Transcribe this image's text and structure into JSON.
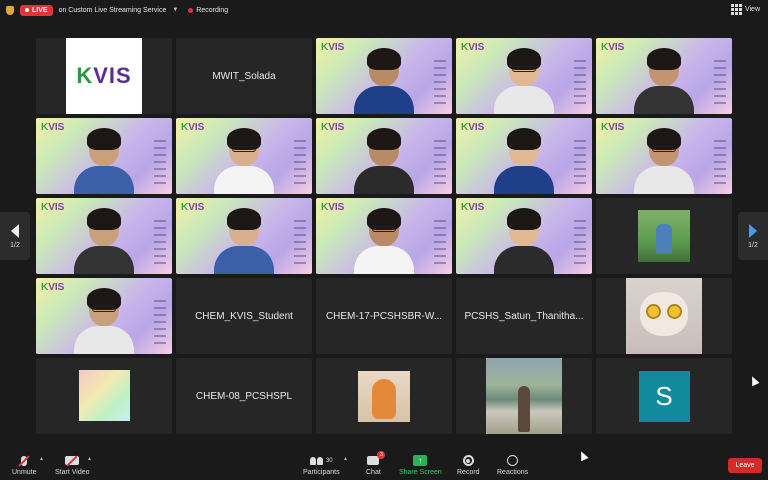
{
  "topbar": {
    "live_label": "LIVE",
    "stream_label": "on Custom Live Streaming Service",
    "recording_label": "Recording",
    "view_label": "View"
  },
  "colors": {
    "live_red": "#e0333a",
    "active_speaker": "#27c24c",
    "share_green": "#28b35b",
    "leave_red": "#d12b2b",
    "page_arrow_blue": "#3aa0f5",
    "avatar_teal": "#128a9e",
    "brand_purple": "#5a2d91",
    "brand_green": "#2f9a3d"
  },
  "kvis_logo": {
    "text_k": "K",
    "text_vis": "VIS"
  },
  "tiles": [
    {
      "type": "logo"
    },
    {
      "type": "name",
      "name": "MWIT_Solada"
    },
    {
      "type": "vbg"
    },
    {
      "type": "vbg",
      "active": true
    },
    {
      "type": "vbg"
    },
    {
      "type": "vbg"
    },
    {
      "type": "vbg"
    },
    {
      "type": "vbg"
    },
    {
      "type": "vbg"
    },
    {
      "type": "vbg"
    },
    {
      "type": "vbg"
    },
    {
      "type": "vbg"
    },
    {
      "type": "vbg"
    },
    {
      "type": "vbg"
    },
    {
      "type": "image",
      "image": "grass-photo"
    },
    {
      "type": "vbg"
    },
    {
      "type": "name",
      "name": "CHEM_KVIS_Student"
    },
    {
      "type": "name",
      "name": "CHEM-17-PCSHSBR-W..."
    },
    {
      "type": "name",
      "name": "PCSHS_Satun_Thanitha..."
    },
    {
      "type": "image",
      "image": "cat-with-glasses"
    },
    {
      "type": "image",
      "image": "gradient-square"
    },
    {
      "type": "name",
      "name": "CHEM-08_PCSHSPL"
    },
    {
      "type": "image",
      "image": "orange-cat"
    },
    {
      "type": "image",
      "image": "lake-photo"
    },
    {
      "type": "avatar",
      "letter": "S"
    }
  ],
  "pagination": {
    "left_label": "1/2",
    "right_label": "1/2"
  },
  "toolbar": {
    "unmute_label": "Unmute",
    "start_video_label": "Start Video",
    "participants_label": "Participants",
    "participants_count": "30",
    "chat_label": "Chat",
    "chat_badge": "3",
    "share_label": "Share Screen",
    "record_label": "Record",
    "reactions_label": "Reactions",
    "leave_label": "Leave"
  }
}
